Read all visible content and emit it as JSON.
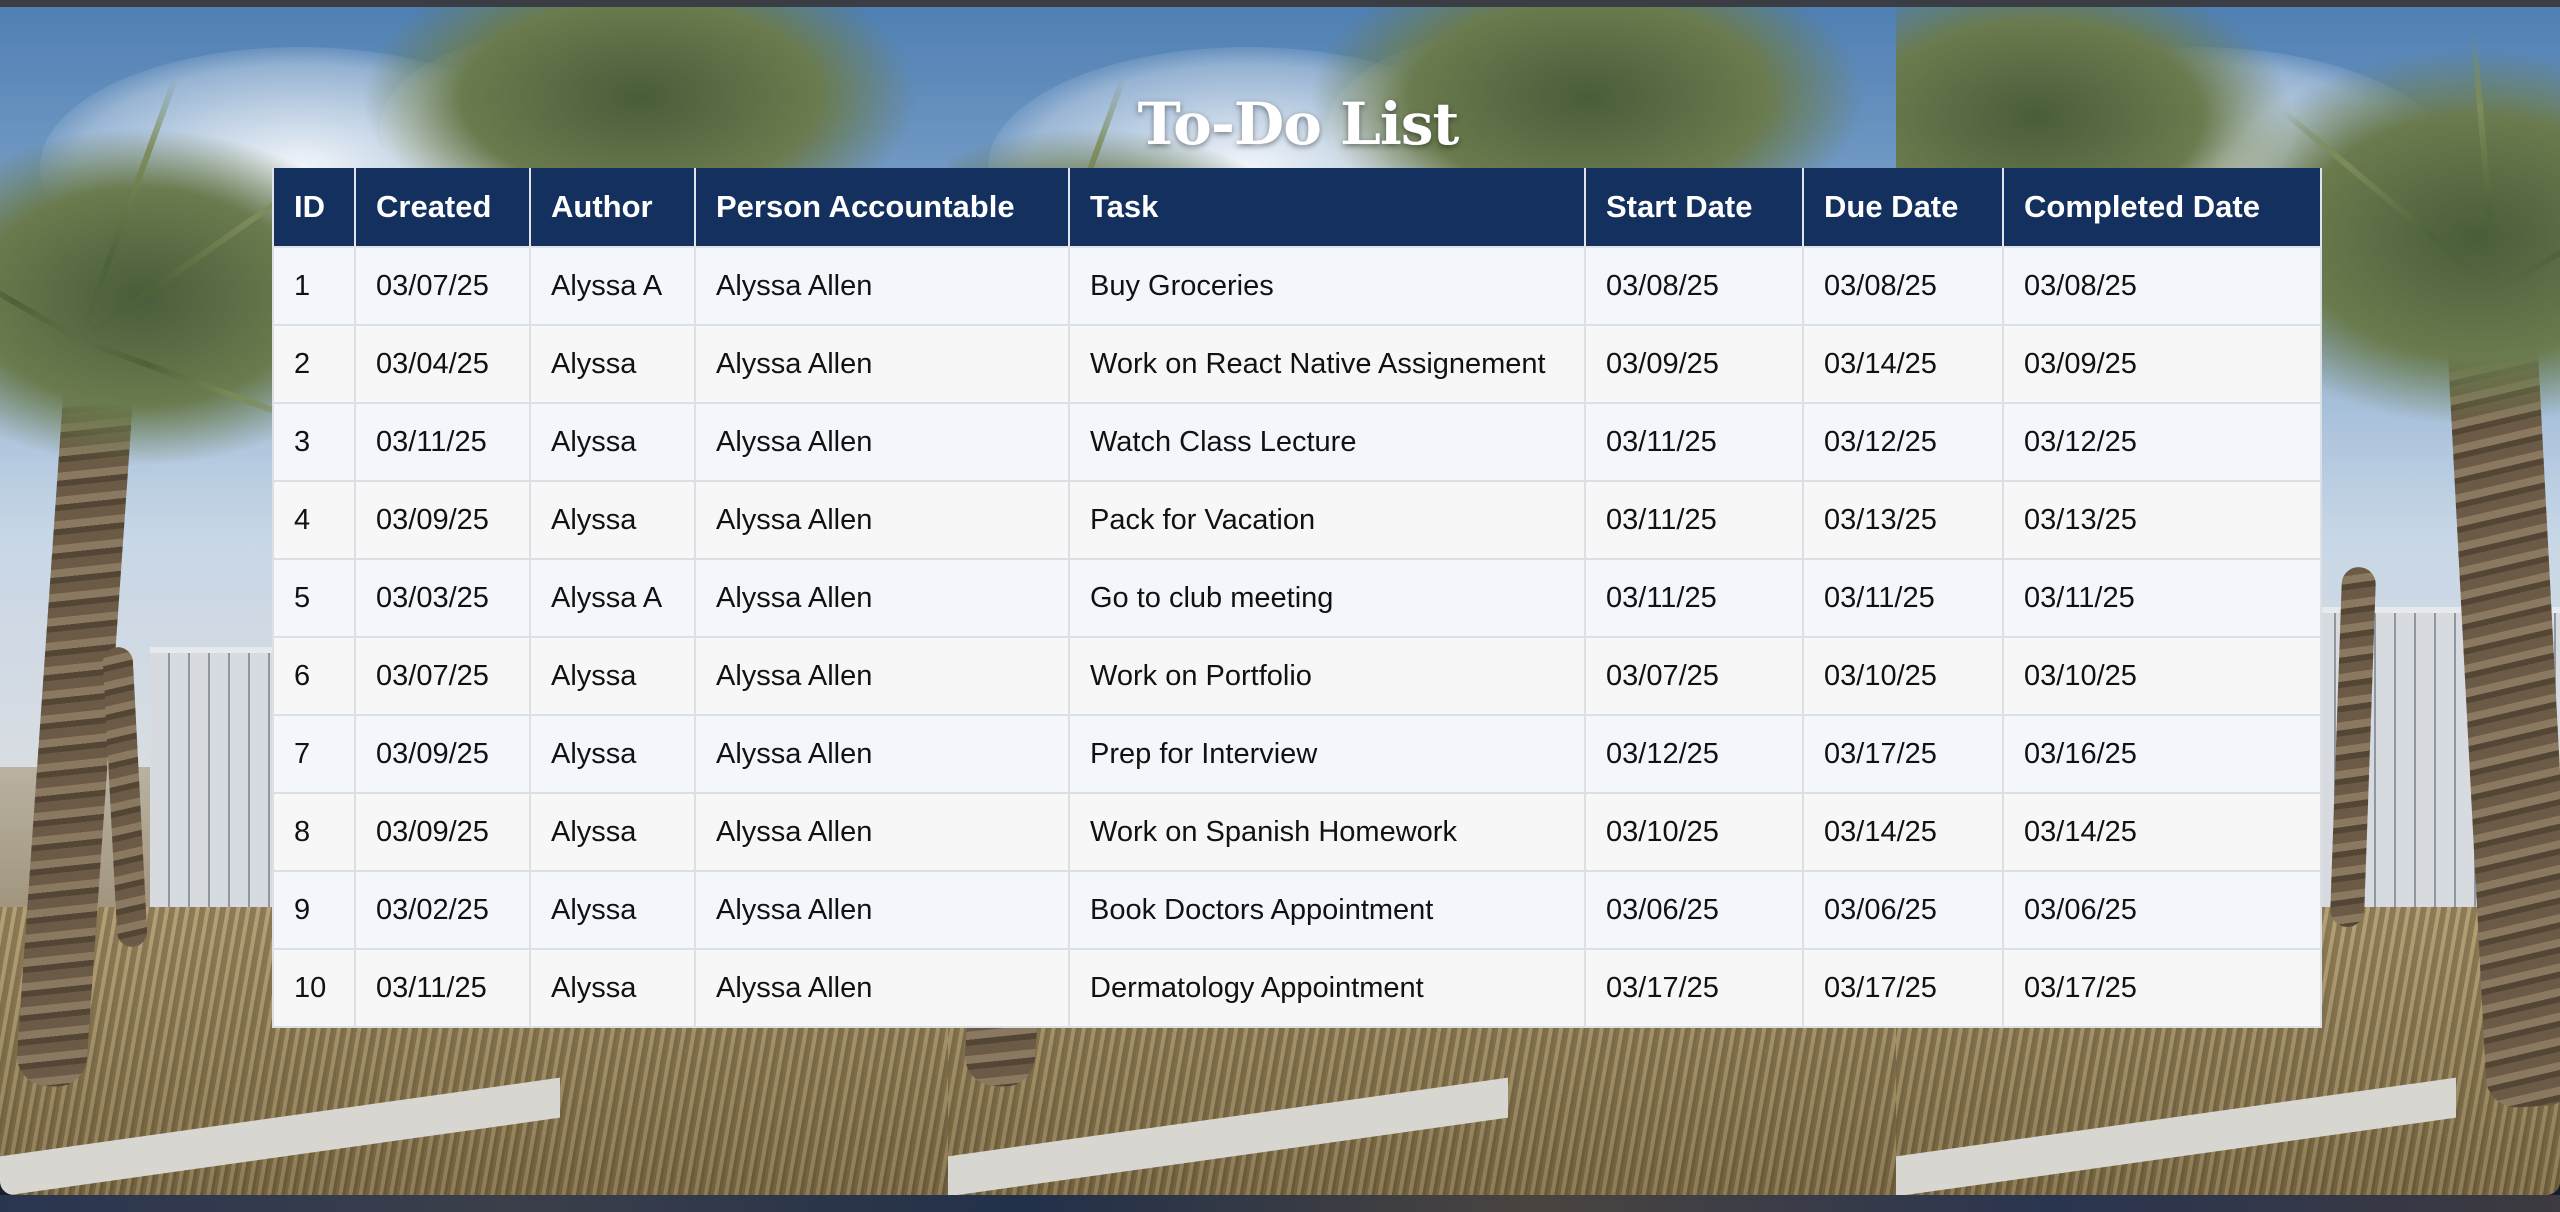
{
  "page": {
    "title": "To-Do List"
  },
  "table": {
    "columns": [
      "ID",
      "Created",
      "Author",
      "Person Accountable",
      "Task",
      "Start Date",
      "Due Date",
      "Completed Date"
    ],
    "rows": [
      [
        "1",
        "03/07/25",
        "Alyssa A",
        "Alyssa Allen",
        "Buy Groceries",
        "03/08/25",
        "03/08/25",
        "03/08/25"
      ],
      [
        "2",
        "03/04/25",
        "Alyssa",
        "Alyssa Allen",
        "Work on React Native Assignement",
        "03/09/25",
        "03/14/25",
        "03/09/25"
      ],
      [
        "3",
        "03/11/25",
        "Alyssa",
        "Alyssa Allen",
        "Watch Class Lecture",
        "03/11/25",
        "03/12/25",
        "03/12/25"
      ],
      [
        "4",
        "03/09/25",
        "Alyssa",
        "Alyssa Allen",
        "Pack for Vacation",
        "03/11/25",
        "03/13/25",
        "03/13/25"
      ],
      [
        "5",
        "03/03/25",
        "Alyssa A",
        "Alyssa Allen",
        "Go to club meeting",
        "03/11/25",
        "03/11/25",
        "03/11/25"
      ],
      [
        "6",
        "03/07/25",
        "Alyssa",
        "Alyssa Allen",
        "Work on Portfolio",
        "03/07/25",
        "03/10/25",
        "03/10/25"
      ],
      [
        "7",
        "03/09/25",
        "Alyssa",
        "Alyssa Allen",
        "Prep for Interview",
        "03/12/25",
        "03/17/25",
        "03/16/25"
      ],
      [
        "8",
        "03/09/25",
        "Alyssa",
        "Alyssa Allen",
        "Work on Spanish Homework",
        "03/10/25",
        "03/14/25",
        "03/14/25"
      ],
      [
        "9",
        "03/02/25",
        "Alyssa",
        "Alyssa Allen",
        "Book Doctors Appointment",
        "03/06/25",
        "03/06/25",
        "03/06/25"
      ],
      [
        "10",
        "03/11/25",
        "Alyssa",
        "Alyssa Allen",
        "Dermatology Appointment",
        "03/17/25",
        "03/17/25",
        "03/17/25"
      ]
    ]
  },
  "colors": {
    "header_bg": "#13305e",
    "header_text": "#ffffff",
    "row_odd": "#f3f7fb",
    "row_even": "#f7f7f7"
  },
  "background": {
    "image_subject": "palm-trees-photo"
  }
}
